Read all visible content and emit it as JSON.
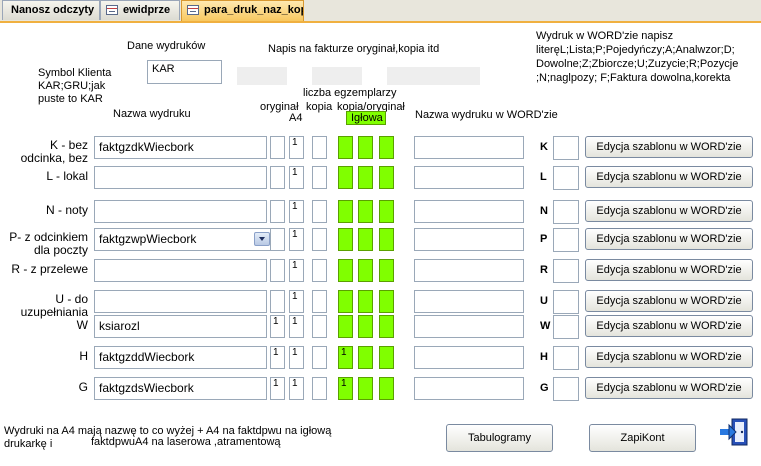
{
  "tabs": [
    {
      "label": "Nanosz odczyty",
      "has_icon": false
    },
    {
      "label": "ewidprze",
      "has_icon": true
    },
    {
      "label": "para_druk_naz_kop",
      "has_icon": true
    }
  ],
  "dane_wydrukow": "Dane wydruków",
  "symbol_klienta": [
    "Symbol Klienta",
    "KAR;GRU;jak",
    "puste to KAR"
  ],
  "symbol_value": "KAR",
  "napis_label": "Napis na fakturze oryginał,kopia itd",
  "word_info": [
    "Wydruk w WORD'zie napisz",
    "literęL;Lista;P;Pojedyńczy;A;Analwzor;D;",
    "Dowolne;Z;Zbiorcze;U;Zuzycie;R;Pozycje",
    ";N;naglpozy; F;Faktura dowolna,korekta"
  ],
  "liczba_egz": "liczba egzemplarzy",
  "headers": {
    "nazwa_wydruku": "Nazwa wydruku",
    "oryginal": "oryginał",
    "a4": "A4",
    "kopia": "kopia",
    "kopia_oryginal": "kopia/oryginał",
    "iglowa": "Igłowa",
    "nazwa_word": "Nazwa wydruku w WORD'zie"
  },
  "rows": [
    {
      "label": [
        "K  - bez",
        "odcinka, bez"
      ],
      "name": "faktgzdkWiecbork",
      "a4": "",
      "oryg": "1",
      "kopia": "",
      "g1": "",
      "g2": "",
      "g3": "",
      "word": "",
      "letter": "K",
      "letter_value": ""
    },
    {
      "label": [
        "L - lokal"
      ],
      "name": "",
      "a4": "",
      "oryg": "1",
      "kopia": "",
      "g1": "",
      "g2": "",
      "g3": "",
      "word": "",
      "letter": "L",
      "letter_value": ""
    },
    {
      "label": [
        "N - noty"
      ],
      "name": "",
      "a4": "",
      "oryg": "1",
      "kopia": "",
      "g1": "",
      "g2": "",
      "g3": "",
      "word": "",
      "letter": "N",
      "letter_value": ""
    },
    {
      "label": [
        "P- z odcinkiem",
        "dla poczty"
      ],
      "name": "faktgzwpWiecbork",
      "a4": "",
      "oryg": "1",
      "kopia": "",
      "g1": "",
      "g2": "",
      "g3": "",
      "word": "",
      "letter": "P",
      "letter_value": ""
    },
    {
      "label": [
        "R - z przelewe"
      ],
      "name": "",
      "a4": "",
      "oryg": "1",
      "kopia": "",
      "g1": "",
      "g2": "",
      "g3": "",
      "word": "",
      "letter": "R",
      "letter_value": ""
    },
    {
      "label": [
        "U - do",
        "uzupełniania"
      ],
      "name": "",
      "a4": "",
      "oryg": "1",
      "kopia": "",
      "g1": "",
      "g2": "",
      "g3": "",
      "word": "",
      "letter": "U",
      "letter_value": ""
    },
    {
      "label": [
        "W"
      ],
      "name": "ksiarozl",
      "a4": "1",
      "oryg": "1",
      "kopia": "",
      "g1": "",
      "g2": "",
      "g3": "",
      "word": "",
      "letter": "W",
      "letter_value": ""
    },
    {
      "label": [
        "H"
      ],
      "name": "faktgzddWiecbork",
      "a4": "1",
      "oryg": "1",
      "kopia": "",
      "g1": "1",
      "g2": "",
      "g3": "",
      "word": "",
      "letter": "H",
      "letter_value": ""
    },
    {
      "label": [
        "G"
      ],
      "name": "faktgzdsWiecbork",
      "a4": "1",
      "oryg": "1",
      "kopia": "",
      "g1": "1",
      "g2": "",
      "g3": "",
      "word": "",
      "letter": "G",
      "letter_value": ""
    }
  ],
  "edit_button_label": "Edycja szablonu w WORD'zie",
  "footer_note": [
    "Wydruki na A4 mają nazwę to co wyżej + A4  na faktdpwu na igłową",
    "drukarkę i",
    "faktdpwuA4 na laserowa ,atramentową"
  ],
  "buttons": {
    "tabulogramy": "Tabulogramy",
    "zapikont": "ZapiKont"
  },
  "colors": {
    "accent_green": "#80ff00",
    "tab_active": "#f8c860"
  }
}
